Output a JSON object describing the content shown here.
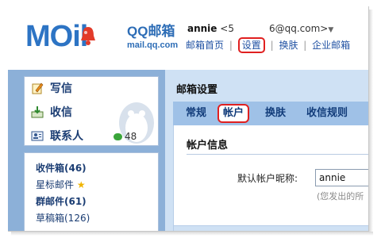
{
  "brand": {
    "logo_text": "MOil",
    "product_name": "QQ邮箱",
    "domain": "mail.qq.com",
    "accent_color": "#2d74c4"
  },
  "user": {
    "name": "annie",
    "email_prefix": "<5",
    "email_suffix": "6@qq.com>",
    "caret": "▼"
  },
  "top_links": [
    {
      "label": "邮箱首页"
    },
    {
      "label": "设置",
      "circled": true
    },
    {
      "label": "换肤"
    },
    {
      "label": "企业邮箱"
    }
  ],
  "sidebar": {
    "quick_actions": [
      {
        "label": "写信",
        "icon": "pencil-icon"
      },
      {
        "label": "收信",
        "icon": "inbox-download-icon"
      },
      {
        "label": "联系人",
        "icon": "contact-card-icon"
      }
    ],
    "online_count": "48",
    "folders": [
      {
        "label": "收件箱(46)",
        "bold": true
      },
      {
        "label": "星标邮件",
        "star": "★"
      },
      {
        "label": "群邮件(61)",
        "bold": true
      },
      {
        "label": "草稿箱(126)"
      }
    ]
  },
  "main": {
    "title": "邮箱设置",
    "tabs": [
      {
        "label": "常规"
      },
      {
        "label": "帐户",
        "active": true
      },
      {
        "label": "换肤"
      },
      {
        "label": "收信规则"
      }
    ],
    "section_title": "帐户信息",
    "nickname_label": "默认帐户昵称:",
    "nickname_value": "annie",
    "nickname_hint": "(您发出的所"
  }
}
